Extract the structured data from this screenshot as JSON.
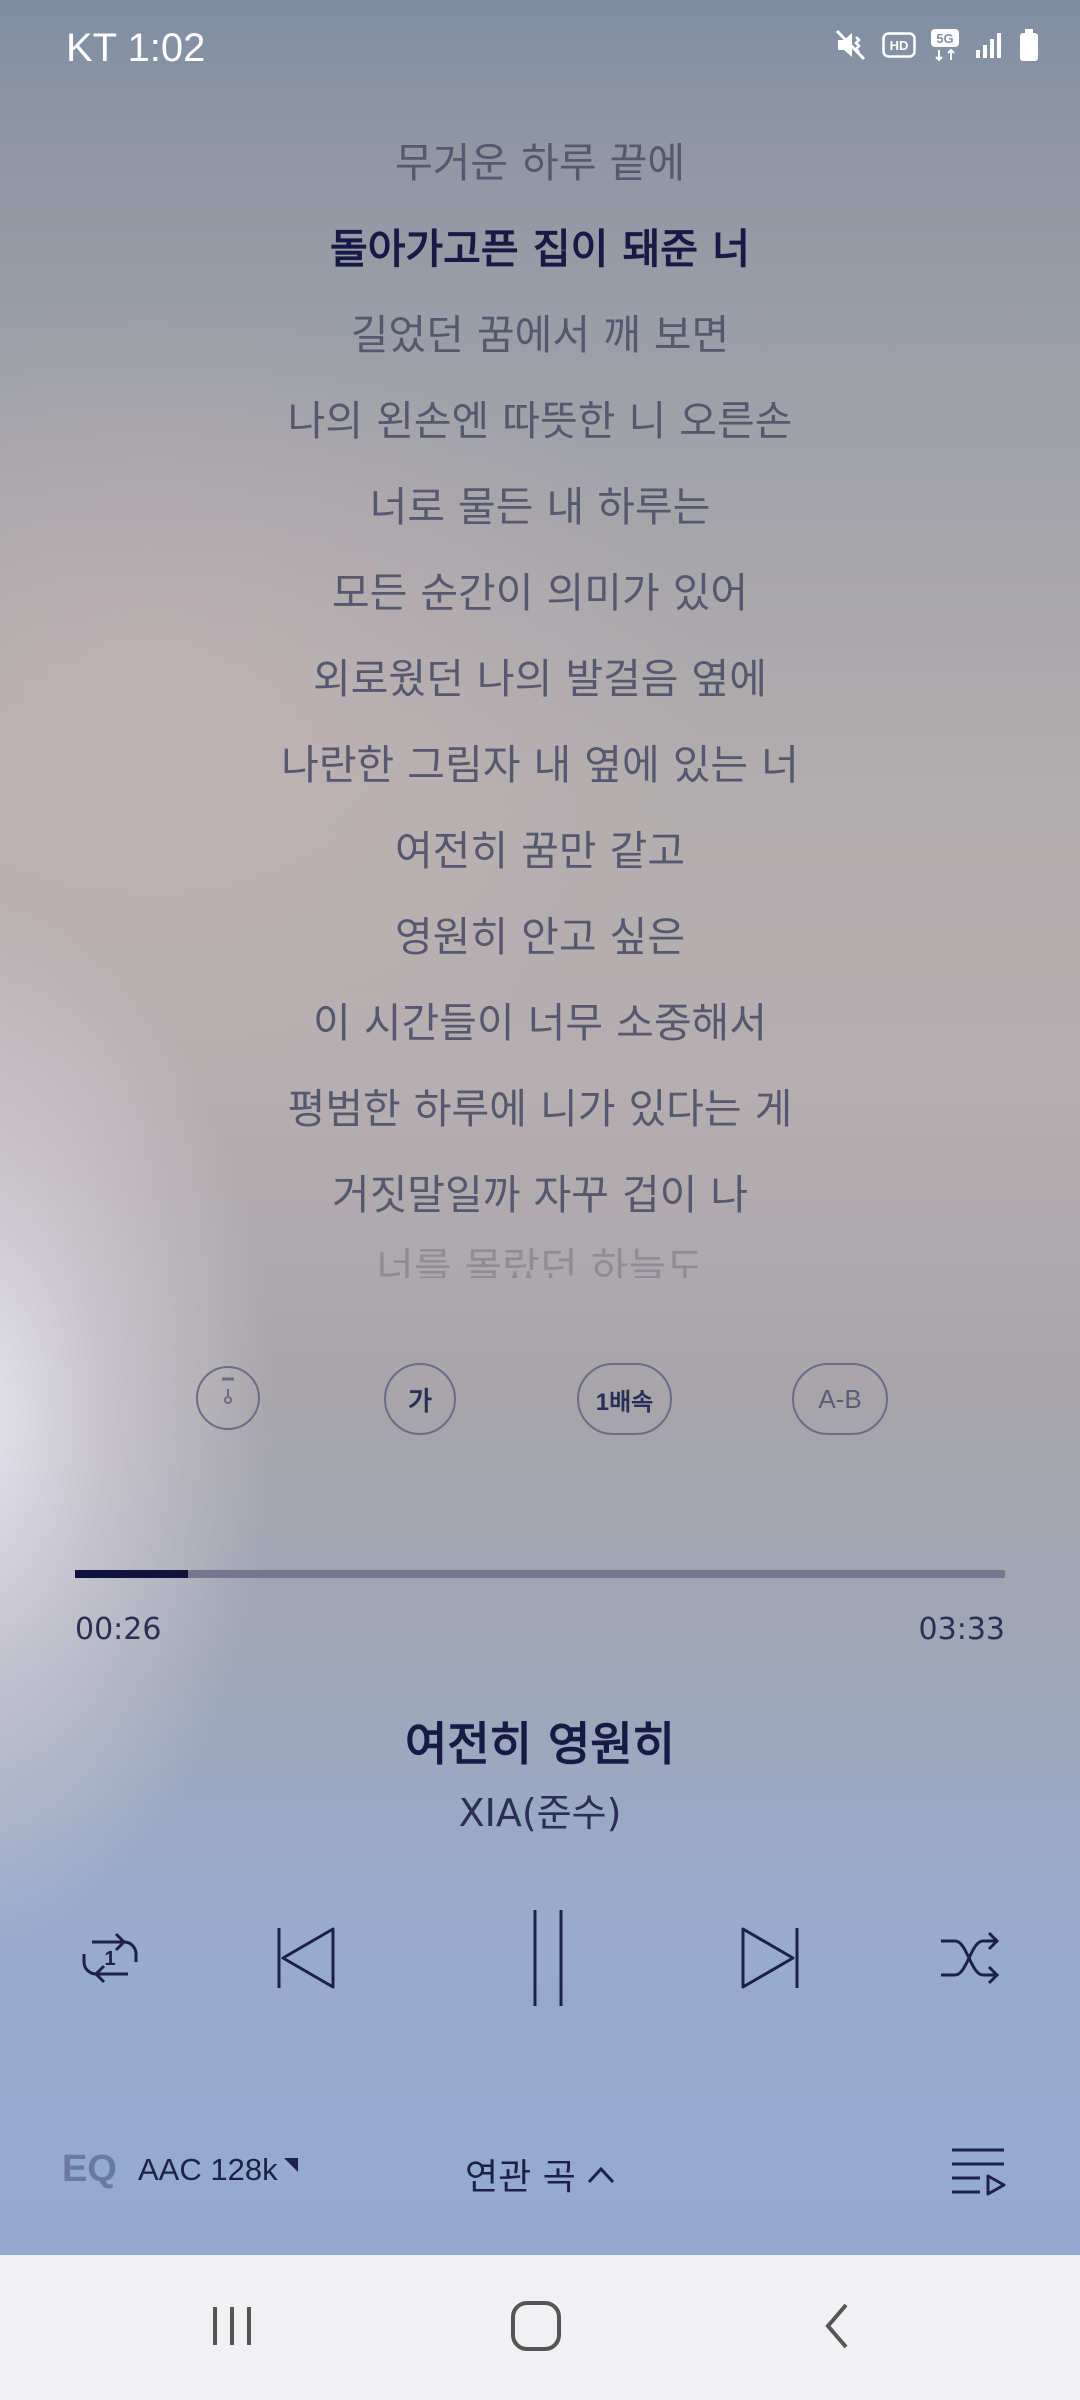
{
  "status_bar": {
    "carrier_time": "KT  1:02",
    "icons": [
      "mute-vibrate-icon",
      "hd-icon",
      "5g-icon",
      "signal-icon",
      "battery-icon"
    ]
  },
  "lyrics": [
    {
      "text": "무거운 하루 끝에",
      "active": false
    },
    {
      "text": "돌아가고픈 집이 돼준 너",
      "active": true
    },
    {
      "text": "길었던 꿈에서 깨 보면",
      "active": false
    },
    {
      "text": "나의 왼손엔 따뜻한 니 오른손",
      "active": false
    },
    {
      "text": "너로 물든 내 하루는",
      "active": false
    },
    {
      "text": "모든 순간이 의미가 있어",
      "active": false
    },
    {
      "text": "외로웠던 나의 발걸음 옆에",
      "active": false
    },
    {
      "text": "나란한 그림자 내 옆에 있는 너",
      "active": false
    },
    {
      "text": "여전히 꿈만 같고",
      "active": false
    },
    {
      "text": "영원히 안고 싶은",
      "active": false
    },
    {
      "text": "이 시간들이 너무 소중해서",
      "active": false
    },
    {
      "text": "평범한 하루에 니가 있다는 게",
      "active": false
    },
    {
      "text": "거짓말일까 자꾸 겁이 나",
      "active": false
    },
    {
      "text": "너를 몰랐던 하늘도",
      "active": false
    }
  ],
  "lyric_controls": {
    "timer_icon": "timer-icon",
    "font_size_label": "가",
    "speed_label": "1배속",
    "ab_repeat_label": "A-B"
  },
  "progress": {
    "elapsed": "00:26",
    "duration": "03:33",
    "fraction": 0.122
  },
  "track": {
    "title": "여전히 영원히",
    "artist": "XIA(준수)"
  },
  "player_controls": {
    "repeat_icon": "repeat-one-icon",
    "repeat_badge": "1",
    "prev_icon": "skip-previous-icon",
    "pause_icon": "pause-icon",
    "next_icon": "skip-next-icon",
    "shuffle_icon": "shuffle-icon"
  },
  "bottom_bar": {
    "eq_label": "EQ",
    "codec_label": "AAC 128k",
    "related_label": "연관 곡",
    "playlist_icon": "playlist-icon"
  },
  "nav_bar": {
    "items": [
      "recents-icon",
      "home-icon",
      "back-icon"
    ]
  },
  "colors": {
    "active_lyric": "#161a45",
    "inactive_lyric": "#55586e",
    "progress_fill": "#11133d",
    "progress_track": "#76778f",
    "eq_accent": "#6a7aa5",
    "nav_bg": "#f1f1f3"
  }
}
